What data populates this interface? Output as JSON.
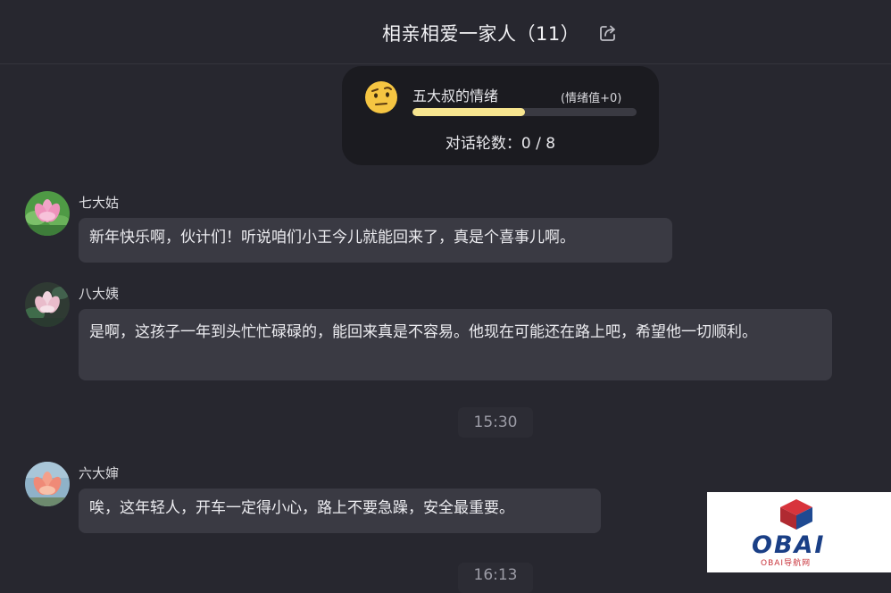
{
  "header": {
    "title": "相亲相爱一家人（11）",
    "share_icon": "share-icon"
  },
  "mood": {
    "name": "五大叔的情绪",
    "value_label": "(情绪值+0)",
    "level": 0.5,
    "round_label": "对话轮数：0 / 8",
    "emoji_icon": "raised-eyebrow-face-icon"
  },
  "messages": [
    {
      "sender": "七大姑",
      "text": "新年快乐啊，伙计们！听说咱们小王今儿就能回来了，真是个喜事儿啊。"
    },
    {
      "sender": "八大姨",
      "text": "是啊，这孩子一年到头忙忙碌碌的，能回来真是不容易。他现在可能还在路上吧，希望他一切顺利。"
    },
    {
      "sender": "六大婶",
      "text": "唉，这年轻人，开车一定得小心，路上不要急躁，安全最重要。"
    }
  ],
  "timestamps": [
    "15:30",
    "16:13"
  ],
  "watermark": {
    "brand": "OBAI",
    "sub": "OBAI导航网"
  },
  "colors": {
    "background": "#27272f",
    "bubble": "#3a3a43",
    "mood_fill": "#f7e58f",
    "watermark_red": "#c8323a",
    "watermark_blue": "#1a3f86"
  }
}
